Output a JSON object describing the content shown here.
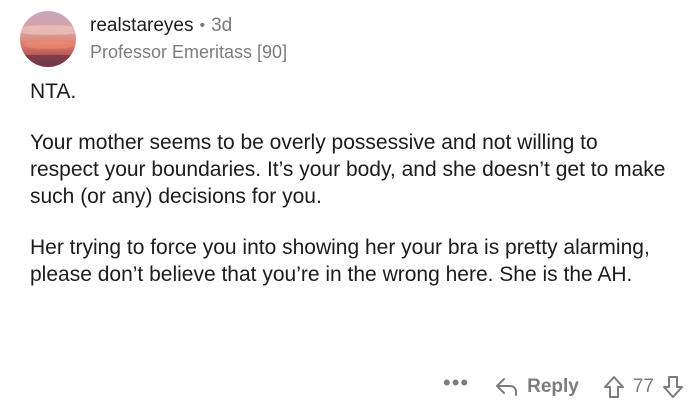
{
  "comment": {
    "author": "realstareyes",
    "separator": "•",
    "age": "3d",
    "flair": "Professor Emeritass [90]",
    "paragraphs": [
      "NTA.",
      "Your mother seems to be overly possessive and not willing to respect your boundaries. It’s your body, and she doesn’t get to make such (or any) decisions for you.",
      "Her trying to force you into showing her your bra is pretty alarming, please don’t believe that you’re in the wrong here. She is the AH."
    ]
  },
  "actions": {
    "more_label": "•••",
    "reply_label": "Reply",
    "score": "77",
    "reply_icon": "reply-arrow-icon",
    "upvote_icon": "upvote-arrow-icon",
    "downvote_icon": "downvote-arrow-icon"
  },
  "colors": {
    "text": "#1c1c1c",
    "muted": "#7c7c7c",
    "background": "#ffffff"
  }
}
